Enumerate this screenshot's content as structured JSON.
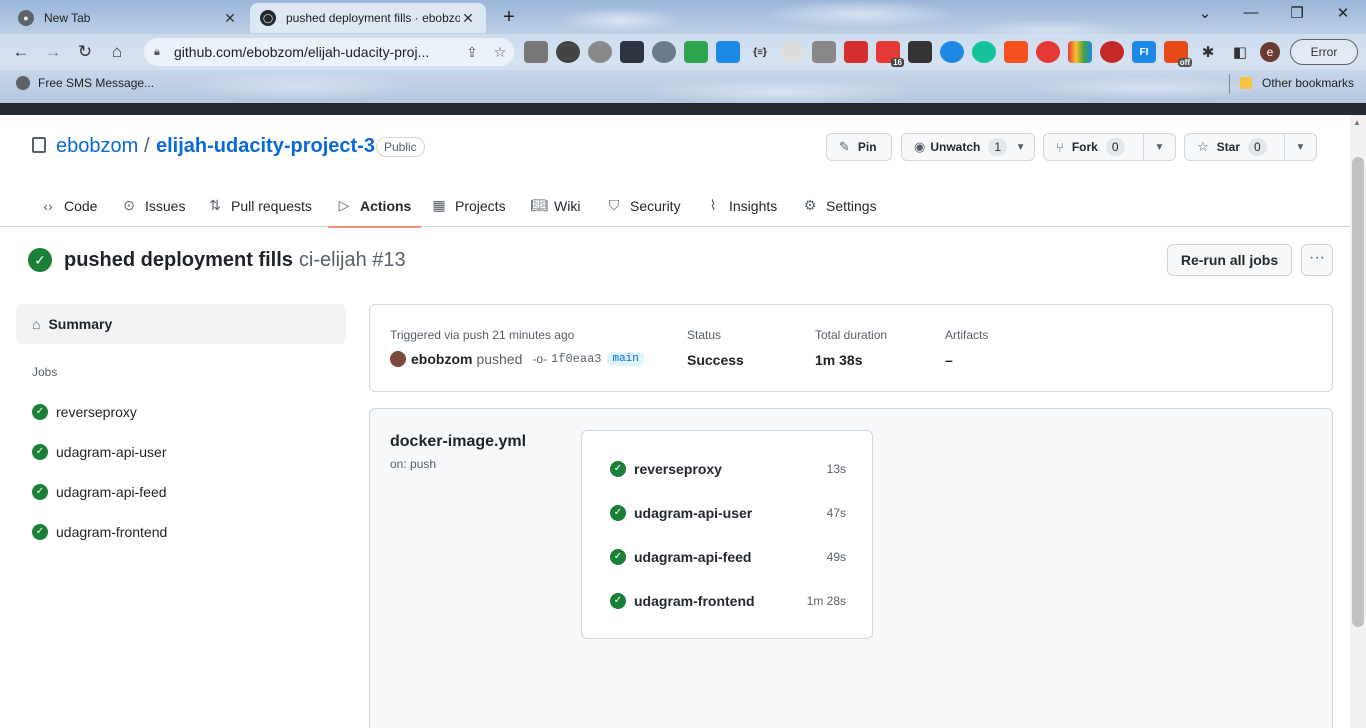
{
  "browser": {
    "tabs": [
      {
        "title": "New Tab",
        "active": false
      },
      {
        "title": "pushed deployment fills · ebobzom",
        "active": true
      }
    ],
    "url": "github.com/ebobzom/elijah-udacity-proj...",
    "profile_initial": "e",
    "error_label": "Error",
    "bookmarks": [
      {
        "label": "Free SMS Message..."
      },
      {
        "label": "Other bookmarks"
      }
    ],
    "extension_badges": {
      "badge_16": "16",
      "badge_off": "off",
      "fi": "FI",
      "sync": "{≡}"
    }
  },
  "repo": {
    "owner": "ebobzom",
    "slash": "/",
    "name": "elijah-udacity-project-3",
    "visibility": "Public",
    "pin_label": "Pin",
    "unwatch_label": "Unwatch",
    "unwatch_count": "1",
    "fork_label": "Fork",
    "fork_count": "0",
    "star_label": "Star",
    "star_count": "0"
  },
  "nav": {
    "code": "Code",
    "issues": "Issues",
    "pulls": "Pull requests",
    "actions": "Actions",
    "projects": "Projects",
    "wiki": "Wiki",
    "security": "Security",
    "insights": "Insights",
    "settings": "Settings"
  },
  "run": {
    "title": "pushed deployment fills",
    "subtitle": "ci-elijah #13",
    "rerun_label": "Re-run all jobs",
    "more_label": "···"
  },
  "sidebar": {
    "summary_label": "Summary",
    "jobs_heading": "Jobs",
    "jobs": [
      "reverseproxy",
      "udagram-api-user",
      "udagram-api-feed",
      "udagram-frontend"
    ]
  },
  "summary_card": {
    "trigger_text": "Triggered via push 21 minutes ago",
    "actor": "ebobzom",
    "verb": "pushed",
    "commit": "1f0eaa3",
    "branch": "main",
    "status_label": "Status",
    "status_value": "Success",
    "duration_label": "Total duration",
    "duration_value": "1m 38s",
    "artifacts_label": "Artifacts",
    "artifacts_value": "–"
  },
  "workflow": {
    "file": "docker-image.yml",
    "trigger": "on: push",
    "jobs": [
      {
        "name": "reverseproxy",
        "duration": "13s"
      },
      {
        "name": "udagram-api-user",
        "duration": "47s"
      },
      {
        "name": "udagram-api-feed",
        "duration": "49s"
      },
      {
        "name": "udagram-frontend",
        "duration": "1m 28s"
      }
    ]
  },
  "colors": {
    "success": "#1a7f37",
    "link": "#0969da",
    "active_tab_underline": "#fd8c73"
  }
}
